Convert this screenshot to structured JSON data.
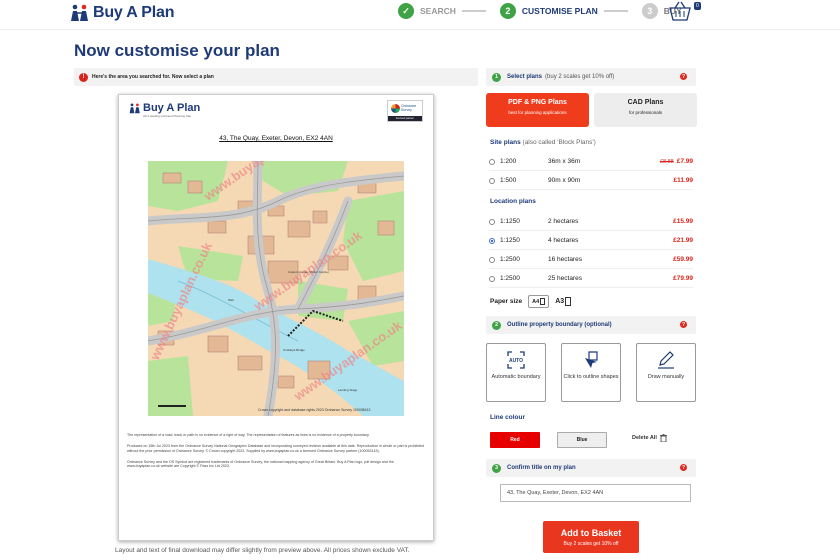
{
  "header": {
    "logo_main": "Buy A Plan",
    "basket_count": "0",
    "steps": [
      {
        "num": "✓",
        "label": "SEARCH",
        "state": "done"
      },
      {
        "num": "2",
        "label": "CUSTOMISE PLAN",
        "state": "active"
      },
      {
        "num": "3",
        "label": "BUY",
        "state": "todo"
      }
    ]
  },
  "page": {
    "title": "Now customise your plan",
    "notice": "Here's the area you searched for. Now select a plan"
  },
  "preview": {
    "logo": "Buy A Plan",
    "tagline": "UK's leading Licensed Planning Site",
    "os_text": "Ordnance Survey",
    "os_bar": "licensed partner",
    "address": "43, The Quay, Exeter, Devon, EX2 4AN",
    "map_copyright": "Crown copyright and database rights 2023 Ordnance Survey 100038413",
    "map_labels": {
      "custom_house": "Custom House (Visitor Centre)",
      "bridge": "Cricklepit Bridge",
      "landing": "Landing Stage",
      "weir": "Weir"
    },
    "notes": [
      "The representation of a road, track or path is no evidence of a right of way. The representation of features as lines is no evidence of a property boundary.",
      "Produced on 15th Jul 2023 from the Ordnance Survey National Geographic Database and incorporating surveyed revision available at this date. Reproduction in whole or part is prohibited without the prior permission of Ordnance Survey. © Crown copyright 2023. Supplied by www.buyaplan.co.uk a licensed Ordnance Survey partner (100053143).",
      "Ordnance Survey and the OS Symbol are registered trademarks of Ordnance Survey, the national mapping agency of Great Britain. Buy A Plan logo, pdf design and the www.buyaplan.co.uk website are Copyright © Pass Inc Ltd 2023."
    ],
    "caption": "Layout and text of final download may differ slightly from preview above. All prices shown exclude VAT."
  },
  "select_plans": {
    "step": "1",
    "title": "Select plans",
    "subtitle": "(buy 2 scales get 10% off)",
    "tabs": [
      {
        "title": "PDF & PNG Plans",
        "sub": "best for planning applications"
      },
      {
        "title": "CAD Plans",
        "sub": "for professionals"
      }
    ],
    "site_label": "Site plans",
    "site_sub": "(also called 'Block Plans')",
    "site_options": [
      {
        "scale": "1:200",
        "size": "36m x 36m",
        "old": "£8.88",
        "price": "£7.99"
      },
      {
        "scale": "1:500",
        "size": "90m x 90m",
        "old": "",
        "price": "£11.99"
      }
    ],
    "location_label": "Location plans",
    "location_options": [
      {
        "scale": "1:1250",
        "size": "2 hectares",
        "price": "£15.99"
      },
      {
        "scale": "1:1250",
        "size": "4 hectares",
        "price": "£21.99"
      },
      {
        "scale": "1:2500",
        "size": "16 hectares",
        "price": "£59.99"
      },
      {
        "scale": "1:2500",
        "size": "25 hectares",
        "price": "£79.99"
      }
    ],
    "selected_location": 1,
    "paper_label": "Paper size",
    "paper_a4": "A4",
    "paper_a3": "A3"
  },
  "outline": {
    "step": "2",
    "title": "Outline property boundary (optional)",
    "tools": [
      {
        "label": "Automatic boundary",
        "icon": "auto-boundary-icon",
        "badge": "AUTO"
      },
      {
        "label": "Click to outline shapes",
        "icon": "click-outline-icon"
      },
      {
        "label": "Draw manually",
        "icon": "pencil-icon"
      }
    ],
    "colour_label": "Line colour",
    "red": "Red",
    "blue": "Blue",
    "delete_all": "Delete All"
  },
  "confirm": {
    "step": "3",
    "title": "Confirm title on my plan",
    "value": "43, The Quay, Exeter, Devon, EX2 4AN"
  },
  "cta": {
    "title": "Add to Basket",
    "sub": "Buy 2 scales get 10% off"
  },
  "colors": {
    "brand_blue": "#1e3a78",
    "brand_red": "#e02a1f",
    "step_green": "#3fa345"
  }
}
